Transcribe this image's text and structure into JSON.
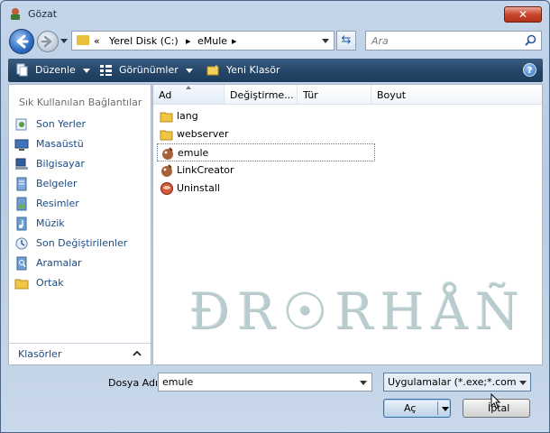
{
  "window": {
    "title": "Gözat",
    "close_label": "✕"
  },
  "address": {
    "parts": [
      "«",
      "Yerel Disk (C:)",
      "▸",
      "eMule",
      "▸"
    ]
  },
  "search": {
    "placeholder": "Ara"
  },
  "toolbar": {
    "organize": "Düzenle",
    "views": "Görünümler",
    "new_folder": "Yeni Klasör",
    "help": "?"
  },
  "navpane": {
    "header": "Sık Kullanılan Bağlantılar",
    "items": [
      {
        "label": "Son Yerler",
        "icon": "recent-places-icon"
      },
      {
        "label": "Masaüstü",
        "icon": "desktop-icon"
      },
      {
        "label": "Bilgisayar",
        "icon": "computer-icon"
      },
      {
        "label": "Belgeler",
        "icon": "documents-icon"
      },
      {
        "label": "Resimler",
        "icon": "pictures-icon"
      },
      {
        "label": "Müzik",
        "icon": "music-icon"
      },
      {
        "label": "Son Değiştirilenler",
        "icon": "recently-changed-icon"
      },
      {
        "label": "Aramalar",
        "icon": "searches-icon"
      },
      {
        "label": "Ortak",
        "icon": "public-folder-icon"
      }
    ],
    "folders_label": "Klasörler"
  },
  "columns": [
    "Ad",
    "Değiştirme...",
    "Tür",
    "Boyut"
  ],
  "files": [
    {
      "name": "lang",
      "icon": "folder-icon"
    },
    {
      "name": "webserver",
      "icon": "folder-icon"
    },
    {
      "name": "emule",
      "icon": "emule-app-icon"
    },
    {
      "name": "LinkCreator",
      "icon": "emule-app-icon"
    },
    {
      "name": "Uninstall",
      "icon": "uninstall-icon"
    }
  ],
  "watermark": "ÐR☉RHÅÑ",
  "bottom": {
    "filename_label": "Dosya Adı:",
    "filename_value": "emule",
    "filter_value": "Uygulamalar (*.exe;*.com;*.ico)",
    "open_label": "Aç",
    "cancel_label": "İptal"
  },
  "colors": {
    "toolbar": "#254668",
    "link_text": "#1b4a84",
    "folder": "#e9c23d",
    "close": "#c8472e"
  }
}
